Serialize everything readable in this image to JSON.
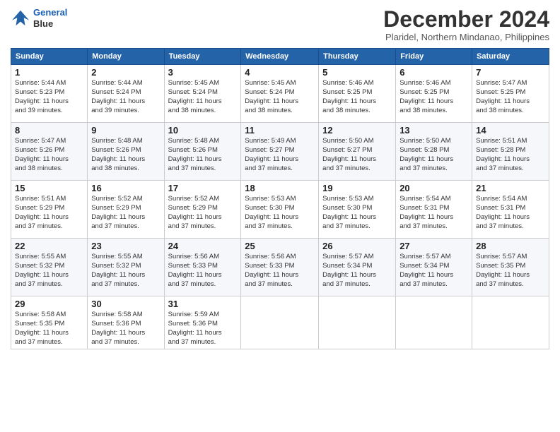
{
  "logo": {
    "line1": "General",
    "line2": "Blue"
  },
  "title": "December 2024",
  "location": "Plaridel, Northern Mindanao, Philippines",
  "days_header": [
    "Sunday",
    "Monday",
    "Tuesday",
    "Wednesday",
    "Thursday",
    "Friday",
    "Saturday"
  ],
  "weeks": [
    [
      {
        "day": "1",
        "sunrise": "5:44 AM",
        "sunset": "5:23 PM",
        "daylight": "11 hours and 39 minutes."
      },
      {
        "day": "2",
        "sunrise": "5:44 AM",
        "sunset": "5:24 PM",
        "daylight": "11 hours and 39 minutes."
      },
      {
        "day": "3",
        "sunrise": "5:45 AM",
        "sunset": "5:24 PM",
        "daylight": "11 hours and 38 minutes."
      },
      {
        "day": "4",
        "sunrise": "5:45 AM",
        "sunset": "5:24 PM",
        "daylight": "11 hours and 38 minutes."
      },
      {
        "day": "5",
        "sunrise": "5:46 AM",
        "sunset": "5:25 PM",
        "daylight": "11 hours and 38 minutes."
      },
      {
        "day": "6",
        "sunrise": "5:46 AM",
        "sunset": "5:25 PM",
        "daylight": "11 hours and 38 minutes."
      },
      {
        "day": "7",
        "sunrise": "5:47 AM",
        "sunset": "5:25 PM",
        "daylight": "11 hours and 38 minutes."
      }
    ],
    [
      {
        "day": "8",
        "sunrise": "5:47 AM",
        "sunset": "5:26 PM",
        "daylight": "11 hours and 38 minutes."
      },
      {
        "day": "9",
        "sunrise": "5:48 AM",
        "sunset": "5:26 PM",
        "daylight": "11 hours and 38 minutes."
      },
      {
        "day": "10",
        "sunrise": "5:48 AM",
        "sunset": "5:26 PM",
        "daylight": "11 hours and 37 minutes."
      },
      {
        "day": "11",
        "sunrise": "5:49 AM",
        "sunset": "5:27 PM",
        "daylight": "11 hours and 37 minutes."
      },
      {
        "day": "12",
        "sunrise": "5:50 AM",
        "sunset": "5:27 PM",
        "daylight": "11 hours and 37 minutes."
      },
      {
        "day": "13",
        "sunrise": "5:50 AM",
        "sunset": "5:28 PM",
        "daylight": "11 hours and 37 minutes."
      },
      {
        "day": "14",
        "sunrise": "5:51 AM",
        "sunset": "5:28 PM",
        "daylight": "11 hours and 37 minutes."
      }
    ],
    [
      {
        "day": "15",
        "sunrise": "5:51 AM",
        "sunset": "5:29 PM",
        "daylight": "11 hours and 37 minutes."
      },
      {
        "day": "16",
        "sunrise": "5:52 AM",
        "sunset": "5:29 PM",
        "daylight": "11 hours and 37 minutes."
      },
      {
        "day": "17",
        "sunrise": "5:52 AM",
        "sunset": "5:29 PM",
        "daylight": "11 hours and 37 minutes."
      },
      {
        "day": "18",
        "sunrise": "5:53 AM",
        "sunset": "5:30 PM",
        "daylight": "11 hours and 37 minutes."
      },
      {
        "day": "19",
        "sunrise": "5:53 AM",
        "sunset": "5:30 PM",
        "daylight": "11 hours and 37 minutes."
      },
      {
        "day": "20",
        "sunrise": "5:54 AM",
        "sunset": "5:31 PM",
        "daylight": "11 hours and 37 minutes."
      },
      {
        "day": "21",
        "sunrise": "5:54 AM",
        "sunset": "5:31 PM",
        "daylight": "11 hours and 37 minutes."
      }
    ],
    [
      {
        "day": "22",
        "sunrise": "5:55 AM",
        "sunset": "5:32 PM",
        "daylight": "11 hours and 37 minutes."
      },
      {
        "day": "23",
        "sunrise": "5:55 AM",
        "sunset": "5:32 PM",
        "daylight": "11 hours and 37 minutes."
      },
      {
        "day": "24",
        "sunrise": "5:56 AM",
        "sunset": "5:33 PM",
        "daylight": "11 hours and 37 minutes."
      },
      {
        "day": "25",
        "sunrise": "5:56 AM",
        "sunset": "5:33 PM",
        "daylight": "11 hours and 37 minutes."
      },
      {
        "day": "26",
        "sunrise": "5:57 AM",
        "sunset": "5:34 PM",
        "daylight": "11 hours and 37 minutes."
      },
      {
        "day": "27",
        "sunrise": "5:57 AM",
        "sunset": "5:34 PM",
        "daylight": "11 hours and 37 minutes."
      },
      {
        "day": "28",
        "sunrise": "5:57 AM",
        "sunset": "5:35 PM",
        "daylight": "11 hours and 37 minutes."
      }
    ],
    [
      {
        "day": "29",
        "sunrise": "5:58 AM",
        "sunset": "5:35 PM",
        "daylight": "11 hours and 37 minutes."
      },
      {
        "day": "30",
        "sunrise": "5:58 AM",
        "sunset": "5:36 PM",
        "daylight": "11 hours and 37 minutes."
      },
      {
        "day": "31",
        "sunrise": "5:59 AM",
        "sunset": "5:36 PM",
        "daylight": "11 hours and 37 minutes."
      },
      null,
      null,
      null,
      null
    ]
  ]
}
